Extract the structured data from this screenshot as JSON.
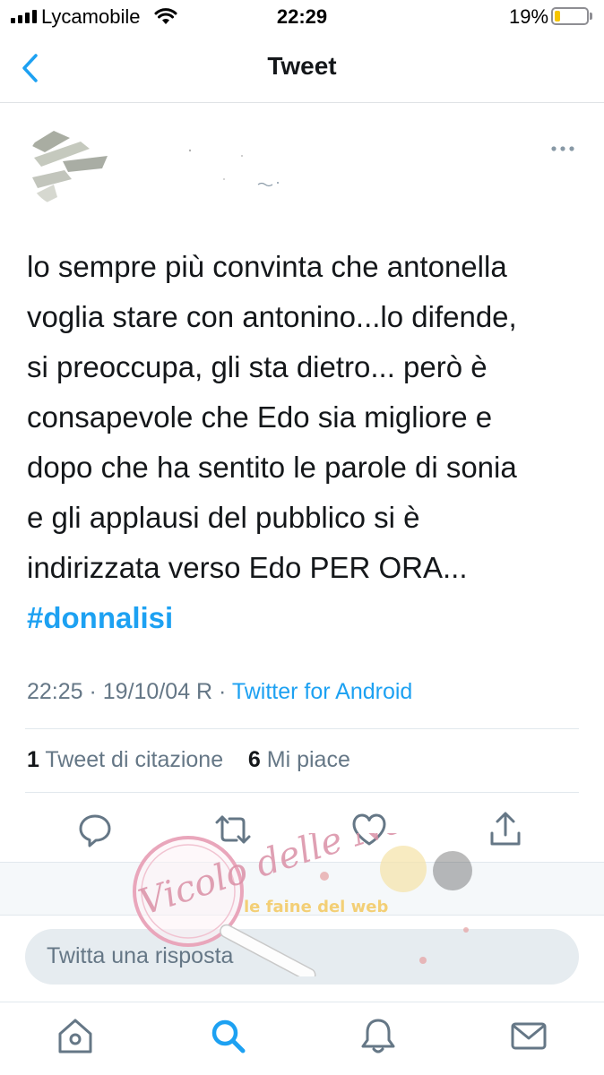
{
  "status_bar": {
    "carrier": "Lycamobile",
    "time": "22:29",
    "battery_percent": "19%",
    "battery_level": 0.19,
    "icons": [
      "signal-icon",
      "wifi-icon",
      "battery-icon"
    ]
  },
  "nav": {
    "title": "Tweet",
    "back_icon": "chevron-left-icon"
  },
  "author": {
    "more_icon": "more-dots-icon"
  },
  "tweet": {
    "text_lines": [
      "lo sempre più convinta che antonella",
      "voglia stare con antonino...lo difende,",
      "si preoccupa, gli sta dietro...  però è",
      "consapevole che Edo sia migliore e",
      "dopo che ha sentito le parole di sonia",
      "e gli applausi del pubblico si è",
      "indirizzata verso Edo PER ORA..."
    ],
    "hashtag": "#donnalisi",
    "timestamp": "22:25 · 19/10/04 R · ",
    "source": "Twitter for Android"
  },
  "stats": {
    "quote_count": "1",
    "quote_label": " Tweet di citazione",
    "likes_count": "6",
    "likes_label": " Mi piace"
  },
  "actions": {
    "icons": [
      "reply-icon",
      "retweet-icon",
      "like-icon",
      "share-icon"
    ]
  },
  "reply": {
    "placeholder": "Twitta una risposta"
  },
  "tab_bar": {
    "icons": [
      "home-icon",
      "search-icon",
      "notifications-icon",
      "messages-icon"
    ],
    "active": "search-icon"
  },
  "watermark": {
    "logo_text": "Vicolo delle News",
    "banner_text": "le faine del web"
  },
  "colors": {
    "accent": "#1da1f2",
    "text_primary": "#14171a",
    "text_secondary": "#657786",
    "divider": "#e1e8ed",
    "battery_low": "#f6c500"
  }
}
